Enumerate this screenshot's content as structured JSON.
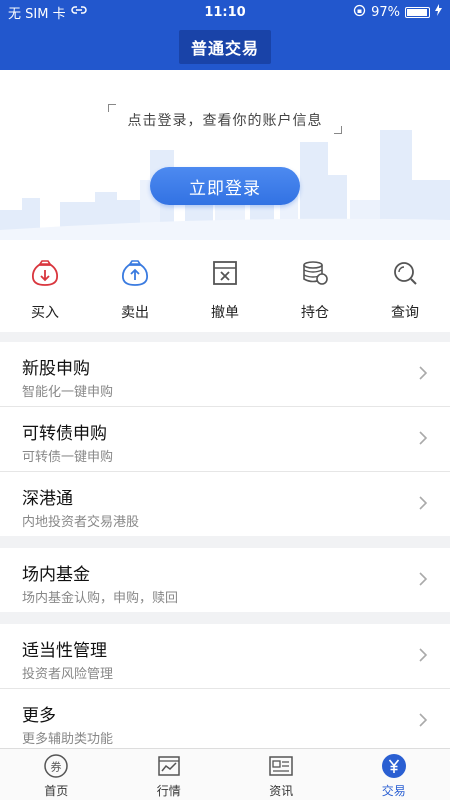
{
  "status_bar": {
    "carrier": "无 SIM 卡",
    "time": "11:10",
    "battery": "97%",
    "battery_level": 0.97
  },
  "header": {
    "title": "普通交易"
  },
  "banner": {
    "tip": "点击登录，查看你的账户信息",
    "login_button": "立即登录"
  },
  "quick_actions": [
    {
      "label": "买入",
      "icon": "buy-icon"
    },
    {
      "label": "卖出",
      "icon": "sell-icon"
    },
    {
      "label": "撤单",
      "icon": "cancel-order-icon"
    },
    {
      "label": "持仓",
      "icon": "holdings-icon"
    },
    {
      "label": "查询",
      "icon": "query-icon"
    }
  ],
  "menu": [
    {
      "title": "新股申购",
      "subtitle": "智能化一键申购"
    },
    {
      "title": "可转债申购",
      "subtitle": "可转债一键申购"
    },
    {
      "title": "深港通",
      "subtitle": "内地投资者交易港股"
    },
    {
      "title": "场内基金",
      "subtitle": "场内基金认购，申购，赎回"
    },
    {
      "title": "适当性管理",
      "subtitle": "投资者风险管理"
    },
    {
      "title": "更多",
      "subtitle": "更多辅助类功能"
    }
  ],
  "tabbar": [
    {
      "label": "首页",
      "icon": "home-coupon-icon"
    },
    {
      "label": "行情",
      "icon": "market-chart-icon"
    },
    {
      "label": "资讯",
      "icon": "news-icon"
    },
    {
      "label": "交易",
      "icon": "trade-yen-icon",
      "active": true
    }
  ],
  "colors": {
    "brand": "#2257cd",
    "accent": "#3272e3",
    "buy": "#d9363e",
    "sell": "#3a7be0"
  }
}
